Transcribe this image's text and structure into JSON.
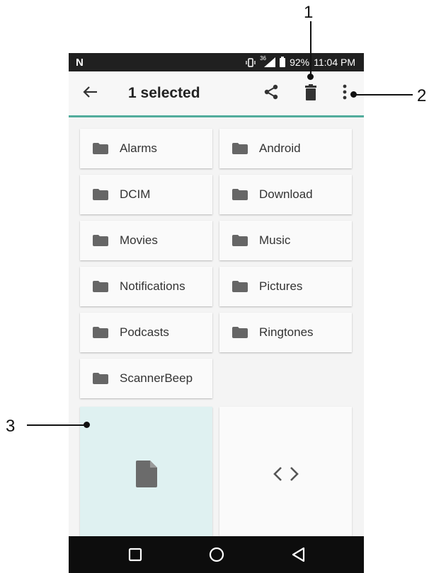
{
  "status_bar": {
    "carrier_icon": "N",
    "network": "36",
    "battery": "92%",
    "time": "11:04 PM"
  },
  "toolbar": {
    "back_icon": "arrow-left",
    "title": "1 selected",
    "share_icon": "share",
    "delete_icon": "trash",
    "more_icon": "more-vertical"
  },
  "folders": [
    {
      "label": "Alarms"
    },
    {
      "label": "Android"
    },
    {
      "label": "DCIM"
    },
    {
      "label": "Download"
    },
    {
      "label": "Movies"
    },
    {
      "label": "Music"
    },
    {
      "label": "Notifications"
    },
    {
      "label": "Pictures"
    },
    {
      "label": "Podcasts"
    },
    {
      "label": "Ringtones"
    },
    {
      "label": "ScannerBeep"
    }
  ],
  "files": [
    {
      "icon": "document",
      "selected": true
    },
    {
      "icon": "code",
      "selected": false
    }
  ],
  "nav_bar": {
    "items": [
      "recents-square",
      "home-circle",
      "back-triangle"
    ]
  },
  "annotations": {
    "one": "1",
    "two": "2",
    "three": "3"
  },
  "colors": {
    "accent": "#52ad9c",
    "selected_tile": "#dff1f1",
    "icon_gray": "#666666"
  }
}
